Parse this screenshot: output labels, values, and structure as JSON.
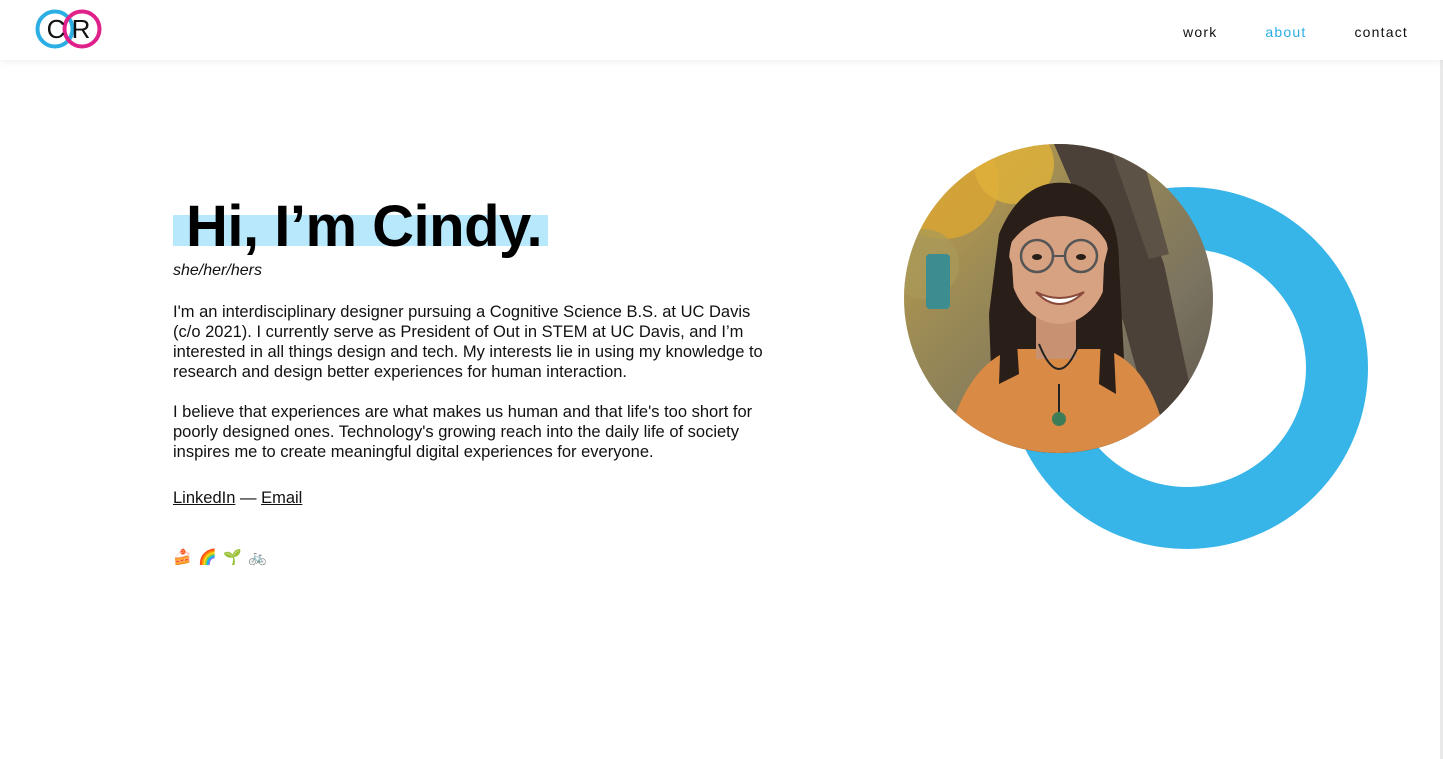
{
  "header": {
    "logo": {
      "letters": [
        "C",
        "R"
      ],
      "colors": {
        "c_ring": "#2aaee3",
        "r_ring": "#e0218a"
      }
    },
    "nav": [
      {
        "label": "work",
        "active": false
      },
      {
        "label": "about",
        "active": true
      },
      {
        "label": "contact",
        "active": false
      }
    ]
  },
  "hero": {
    "title": "Hi, I’m Cindy.",
    "pronouns": "she/her/hers",
    "bio": [
      "I'm an interdisciplinary designer pursuing a Cognitive Science B.S. at UC Davis (c/o 2021). I currently serve as President of Out in STEM at UC Davis, and I’m interested in all things design and tech. My interests lie in using my knowledge to research and design better experiences for human interaction.",
      "I believe that experiences are what makes us human and that life's too short for poorly designed ones. Technology's growing reach into the daily life of society inspires me to create meaningful digital experiences for everyone."
    ],
    "links": {
      "linkedin": "LinkedIn",
      "separator": "—",
      "email": "Email"
    },
    "emojis": [
      "🍰",
      "🌈",
      "🌱",
      "🚲"
    ]
  },
  "colors": {
    "accent": "#2aaee3",
    "ring": "#38b5e8",
    "highlight": "#b7e8fc",
    "logo_pink": "#e0218a"
  },
  "photo": {
    "icon": "profile-photo"
  }
}
